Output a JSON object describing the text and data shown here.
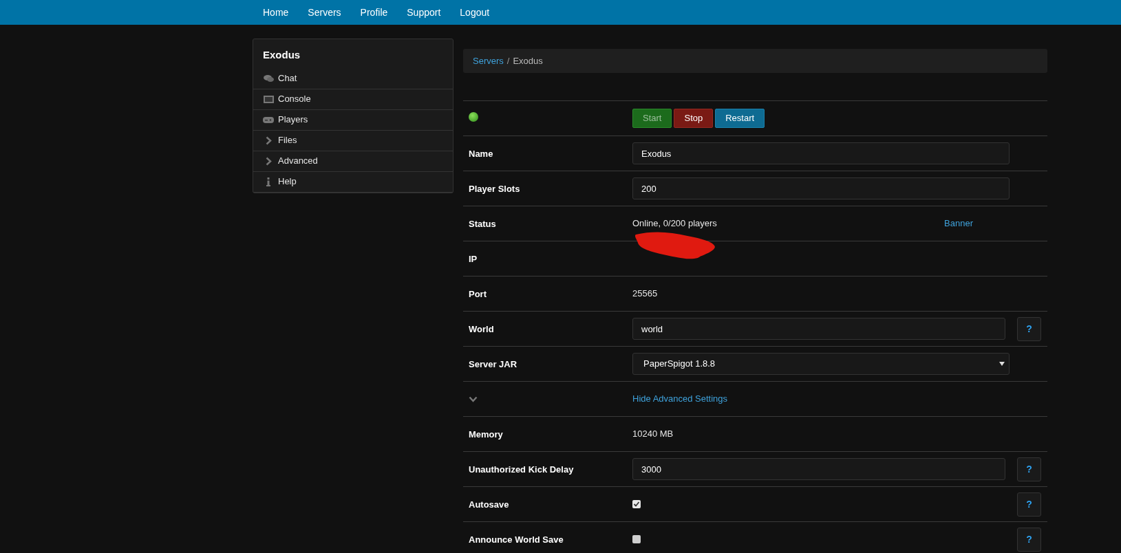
{
  "nav": {
    "items": [
      {
        "label": "Home"
      },
      {
        "label": "Servers"
      },
      {
        "label": "Profile"
      },
      {
        "label": "Support"
      },
      {
        "label": "Logout"
      }
    ]
  },
  "sidebar": {
    "title": "Exodus",
    "items": [
      {
        "label": "Chat",
        "kind": "chat"
      },
      {
        "label": "Console",
        "kind": "console"
      },
      {
        "label": "Players",
        "kind": "players"
      },
      {
        "label": "Files",
        "kind": "folder"
      },
      {
        "label": "Advanced",
        "kind": "folder"
      },
      {
        "label": "Help",
        "kind": "help"
      }
    ]
  },
  "breadcrumb": {
    "link": "Servers",
    "separator": "/",
    "current": "Exodus"
  },
  "rows": [
    {
      "kind": "actions",
      "online": true,
      "buttons": [
        {
          "label": "Start",
          "kind": "start",
          "disabled": true
        },
        {
          "label": "Stop",
          "kind": "stop",
          "disabled": false
        },
        {
          "label": "Restart",
          "kind": "restart",
          "disabled": false
        }
      ]
    },
    {
      "kind": "input",
      "label": "Name",
      "value": "Exodus"
    },
    {
      "kind": "input",
      "label": "Player Slots",
      "value": "200"
    },
    {
      "kind": "text",
      "label": "Status",
      "value": "Online, 0/200 players",
      "link": "Banner"
    },
    {
      "kind": "redacted",
      "label": "IP"
    },
    {
      "kind": "text",
      "label": "Port",
      "value": "25565"
    },
    {
      "kind": "input",
      "label": "World",
      "value": "world",
      "help": "?"
    },
    {
      "kind": "select",
      "label": "Server JAR",
      "value": "PaperSpigot 1.8.8"
    },
    {
      "kind": "toggle",
      "expanded": true,
      "link": "Hide Advanced Settings"
    },
    {
      "kind": "text",
      "label": "Memory",
      "value": "10240 MB"
    },
    {
      "kind": "input",
      "label": "Unauthorized Kick Delay",
      "value": "3000",
      "help": "?"
    },
    {
      "kind": "checkbox",
      "label": "Autosave",
      "checked": true,
      "help": "?"
    },
    {
      "kind": "checkbox",
      "label": "Announce World Save",
      "checked": false,
      "help": "?"
    }
  ]
}
